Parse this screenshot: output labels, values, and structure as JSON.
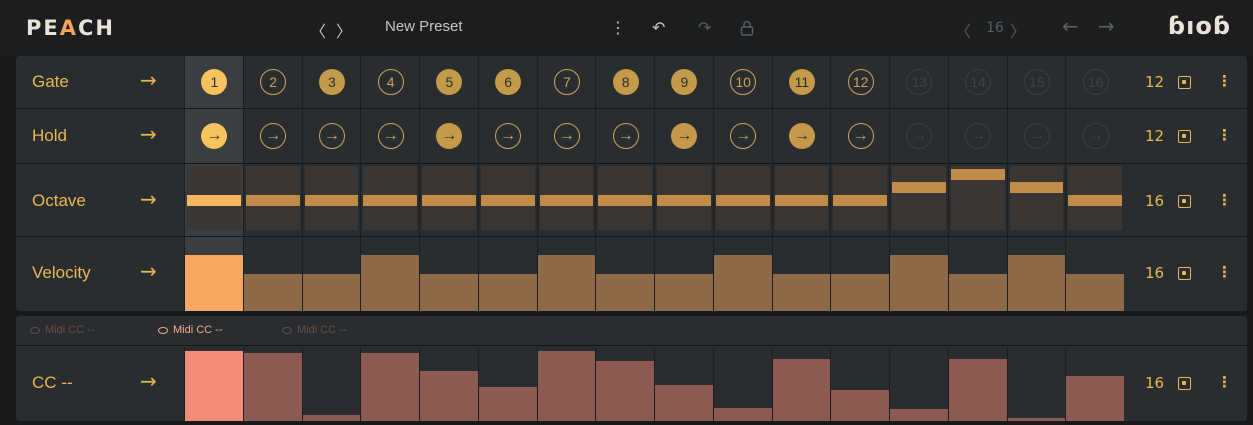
{
  "app": {
    "logo_pre": "PE",
    "logo_a": "A",
    "logo_post": "CH",
    "brand": "ɓıoɓ"
  },
  "toolbar": {
    "prev": "〈",
    "next": "〉",
    "preset_name": "New Preset",
    "menu": "⋮",
    "undo": "↶",
    "redo": "↷",
    "lock": "🔒",
    "steps_prev": "〈",
    "steps_value": "16",
    "steps_next": "〉",
    "nav_left": "←",
    "nav_right": "→"
  },
  "lanes": {
    "gate": {
      "label": "Gate",
      "arrow": "→",
      "count": "12",
      "menu": "⋮",
      "steps": [
        {
          "n": "1",
          "state": "on"
        },
        {
          "n": "2",
          "state": "off"
        },
        {
          "n": "3",
          "state": "on"
        },
        {
          "n": "4",
          "state": "off"
        },
        {
          "n": "5",
          "state": "on"
        },
        {
          "n": "6",
          "state": "on"
        },
        {
          "n": "7",
          "state": "off"
        },
        {
          "n": "8",
          "state": "on"
        },
        {
          "n": "9",
          "state": "on"
        },
        {
          "n": "10",
          "state": "off"
        },
        {
          "n": "11",
          "state": "on"
        },
        {
          "n": "12",
          "state": "off"
        },
        {
          "n": "13",
          "state": "dis"
        },
        {
          "n": "14",
          "state": "dis"
        },
        {
          "n": "15",
          "state": "dis"
        },
        {
          "n": "16",
          "state": "dis"
        }
      ]
    },
    "hold": {
      "label": "Hold",
      "arrow": "→",
      "count": "12",
      "menu": "⋮",
      "glyph": "→",
      "steps": [
        "on",
        "off",
        "off",
        "off",
        "on",
        "off",
        "off",
        "off",
        "on",
        "off",
        "on",
        "off",
        "dis",
        "dis",
        "dis",
        "dis"
      ]
    },
    "octave": {
      "label": "Octave",
      "arrow": "→",
      "count": "16",
      "menu": "⋮",
      "levels": [
        0,
        0,
        0,
        0,
        0,
        0,
        0,
        0,
        0,
        0,
        0,
        0,
        1,
        2,
        1,
        0
      ]
    },
    "velocity": {
      "label": "Velocity",
      "arrow": "→",
      "count": "16",
      "menu": "⋮",
      "values": [
        1.0,
        0.66,
        0.66,
        1.0,
        0.66,
        0.66,
        1.0,
        0.66,
        0.66,
        1.0,
        0.66,
        0.66,
        1.0,
        0.66,
        1.0,
        0.66
      ]
    }
  },
  "cc": {
    "tabs": [
      {
        "label": "Midi CC --",
        "active": false
      },
      {
        "label": "Midi CC --",
        "active": true
      },
      {
        "label": "Midi CC --",
        "active": false
      }
    ],
    "label": "CC --",
    "arrow": "→",
    "count": "16",
    "menu": "⋮",
    "values": [
      1.0,
      0.97,
      0.08,
      0.97,
      0.71,
      0.49,
      1.0,
      0.86,
      0.52,
      0.19,
      0.89,
      0.45,
      0.17,
      0.89,
      0.05,
      0.65
    ]
  }
}
